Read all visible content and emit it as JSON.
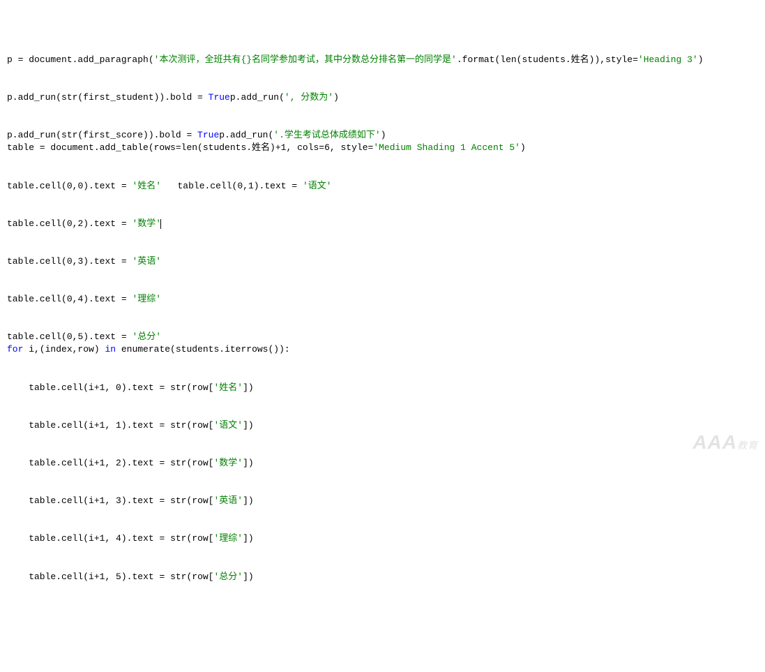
{
  "lines": [
    {
      "type": "code",
      "tokens": [
        {
          "t": "p = document.add_paragraph(",
          "c": "c-default"
        },
        {
          "t": "'本次测评，全班共有{}名同学参加考试，其中分数总分排名第一的同学是'",
          "c": "c-string"
        },
        {
          "t": ".format(len(students.姓名)),style=",
          "c": "c-default"
        },
        {
          "t": "'Heading 3'",
          "c": "c-string"
        },
        {
          "t": ")",
          "c": "c-default"
        }
      ]
    },
    {
      "type": "blank"
    },
    {
      "type": "blank"
    },
    {
      "type": "code",
      "tokens": [
        {
          "t": "p.add_run(str(first_student)).bold = ",
          "c": "c-default"
        },
        {
          "t": "True",
          "c": "c-keyword"
        },
        {
          "t": "p.add_run(",
          "c": "c-default"
        },
        {
          "t": "', 分数为'",
          "c": "c-string"
        },
        {
          "t": ")",
          "c": "c-default"
        }
      ]
    },
    {
      "type": "blank"
    },
    {
      "type": "blank"
    },
    {
      "type": "code",
      "tokens": [
        {
          "t": "p.add_run(str(first_score)).bold = ",
          "c": "c-default"
        },
        {
          "t": "True",
          "c": "c-keyword"
        },
        {
          "t": "p.add_run(",
          "c": "c-default"
        },
        {
          "t": "'.学生考试总体成绩如下'",
          "c": "c-string"
        },
        {
          "t": ")",
          "c": "c-default"
        }
      ]
    },
    {
      "type": "code",
      "tokens": [
        {
          "t": "table = document.add_table(rows=len(students.姓名)+",
          "c": "c-default"
        },
        {
          "t": "1",
          "c": "c-number"
        },
        {
          "t": ", cols=",
          "c": "c-default"
        },
        {
          "t": "6",
          "c": "c-number"
        },
        {
          "t": ", style=",
          "c": "c-default"
        },
        {
          "t": "'Medium Shading 1 Accent 5'",
          "c": "c-string"
        },
        {
          "t": ")",
          "c": "c-default"
        }
      ]
    },
    {
      "type": "blank"
    },
    {
      "type": "blank"
    },
    {
      "type": "code",
      "tokens": [
        {
          "t": "table.cell(",
          "c": "c-default"
        },
        {
          "t": "0",
          "c": "c-number"
        },
        {
          "t": ",",
          "c": "c-default"
        },
        {
          "t": "0",
          "c": "c-number"
        },
        {
          "t": ").text = ",
          "c": "c-default"
        },
        {
          "t": "'姓名'",
          "c": "c-string"
        },
        {
          "t": "   table.cell(",
          "c": "c-default"
        },
        {
          "t": "0",
          "c": "c-number"
        },
        {
          "t": ",",
          "c": "c-default"
        },
        {
          "t": "1",
          "c": "c-number"
        },
        {
          "t": ").text = ",
          "c": "c-default"
        },
        {
          "t": "'语文'",
          "c": "c-string"
        }
      ]
    },
    {
      "type": "blank"
    },
    {
      "type": "blank"
    },
    {
      "type": "code",
      "cursor": true,
      "tokens": [
        {
          "t": "table.cell(",
          "c": "c-default"
        },
        {
          "t": "0",
          "c": "c-number"
        },
        {
          "t": ",",
          "c": "c-default"
        },
        {
          "t": "2",
          "c": "c-number"
        },
        {
          "t": ").text = ",
          "c": "c-default"
        },
        {
          "t": "'数学'",
          "c": "c-string"
        }
      ]
    },
    {
      "type": "blank"
    },
    {
      "type": "blank"
    },
    {
      "type": "code",
      "tokens": [
        {
          "t": "table.cell(",
          "c": "c-default"
        },
        {
          "t": "0",
          "c": "c-number"
        },
        {
          "t": ",",
          "c": "c-default"
        },
        {
          "t": "3",
          "c": "c-number"
        },
        {
          "t": ").text = ",
          "c": "c-default"
        },
        {
          "t": "'英语'",
          "c": "c-string"
        }
      ]
    },
    {
      "type": "blank"
    },
    {
      "type": "blank"
    },
    {
      "type": "code",
      "tokens": [
        {
          "t": "table.cell(",
          "c": "c-default"
        },
        {
          "t": "0",
          "c": "c-number"
        },
        {
          "t": ",",
          "c": "c-default"
        },
        {
          "t": "4",
          "c": "c-number"
        },
        {
          "t": ").text = ",
          "c": "c-default"
        },
        {
          "t": "'理综'",
          "c": "c-string"
        }
      ]
    },
    {
      "type": "blank"
    },
    {
      "type": "blank"
    },
    {
      "type": "code",
      "tokens": [
        {
          "t": "table.cell(",
          "c": "c-default"
        },
        {
          "t": "0",
          "c": "c-number"
        },
        {
          "t": ",",
          "c": "c-default"
        },
        {
          "t": "5",
          "c": "c-number"
        },
        {
          "t": ").text = ",
          "c": "c-default"
        },
        {
          "t": "'总分'",
          "c": "c-string"
        }
      ]
    },
    {
      "type": "code",
      "tokens": [
        {
          "t": "for",
          "c": "c-keyword"
        },
        {
          "t": " i,(index,row) ",
          "c": "c-default"
        },
        {
          "t": "in",
          "c": "c-keyword"
        },
        {
          "t": " enumerate(students.iterrows()):",
          "c": "c-default"
        }
      ]
    },
    {
      "type": "blank"
    },
    {
      "type": "blank"
    },
    {
      "type": "code",
      "tokens": [
        {
          "t": "    table.cell(i+",
          "c": "c-default"
        },
        {
          "t": "1",
          "c": "c-number"
        },
        {
          "t": ", ",
          "c": "c-default"
        },
        {
          "t": "0",
          "c": "c-number"
        },
        {
          "t": ").text = str(row[",
          "c": "c-default"
        },
        {
          "t": "'姓名'",
          "c": "c-string"
        },
        {
          "t": "])",
          "c": "c-default"
        }
      ]
    },
    {
      "type": "blank"
    },
    {
      "type": "blank"
    },
    {
      "type": "code",
      "tokens": [
        {
          "t": "    table.cell(i+",
          "c": "c-default"
        },
        {
          "t": "1",
          "c": "c-number"
        },
        {
          "t": ", ",
          "c": "c-default"
        },
        {
          "t": "1",
          "c": "c-number"
        },
        {
          "t": ").text = str(row[",
          "c": "c-default"
        },
        {
          "t": "'语文'",
          "c": "c-string"
        },
        {
          "t": "])",
          "c": "c-default"
        }
      ]
    },
    {
      "type": "blank"
    },
    {
      "type": "blank"
    },
    {
      "type": "code",
      "tokens": [
        {
          "t": "    table.cell(i+",
          "c": "c-default"
        },
        {
          "t": "1",
          "c": "c-number"
        },
        {
          "t": ", ",
          "c": "c-default"
        },
        {
          "t": "2",
          "c": "c-number"
        },
        {
          "t": ").text = str(row[",
          "c": "c-default"
        },
        {
          "t": "'数学'",
          "c": "c-string"
        },
        {
          "t": "])",
          "c": "c-default"
        }
      ]
    },
    {
      "type": "blank"
    },
    {
      "type": "blank"
    },
    {
      "type": "code",
      "tokens": [
        {
          "t": "    table.cell(i+",
          "c": "c-default"
        },
        {
          "t": "1",
          "c": "c-number"
        },
        {
          "t": ", ",
          "c": "c-default"
        },
        {
          "t": "3",
          "c": "c-number"
        },
        {
          "t": ").text = str(row[",
          "c": "c-default"
        },
        {
          "t": "'英语'",
          "c": "c-string"
        },
        {
          "t": "])",
          "c": "c-default"
        }
      ]
    },
    {
      "type": "blank"
    },
    {
      "type": "blank"
    },
    {
      "type": "code",
      "tokens": [
        {
          "t": "    table.cell(i+",
          "c": "c-default"
        },
        {
          "t": "1",
          "c": "c-number"
        },
        {
          "t": ", ",
          "c": "c-default"
        },
        {
          "t": "4",
          "c": "c-number"
        },
        {
          "t": ").text = str(row[",
          "c": "c-default"
        },
        {
          "t": "'理综'",
          "c": "c-string"
        },
        {
          "t": "])",
          "c": "c-default"
        }
      ]
    },
    {
      "type": "blank"
    },
    {
      "type": "blank"
    },
    {
      "type": "code",
      "tokens": [
        {
          "t": "    table.cell(i+",
          "c": "c-default"
        },
        {
          "t": "1",
          "c": "c-number"
        },
        {
          "t": ", ",
          "c": "c-default"
        },
        {
          "t": "5",
          "c": "c-number"
        },
        {
          "t": ").text = str(row[",
          "c": "c-default"
        },
        {
          "t": "'总分'",
          "c": "c-string"
        },
        {
          "t": "])",
          "c": "c-default"
        }
      ]
    }
  ],
  "watermark": {
    "main": "AAA",
    "sub": "教育"
  }
}
